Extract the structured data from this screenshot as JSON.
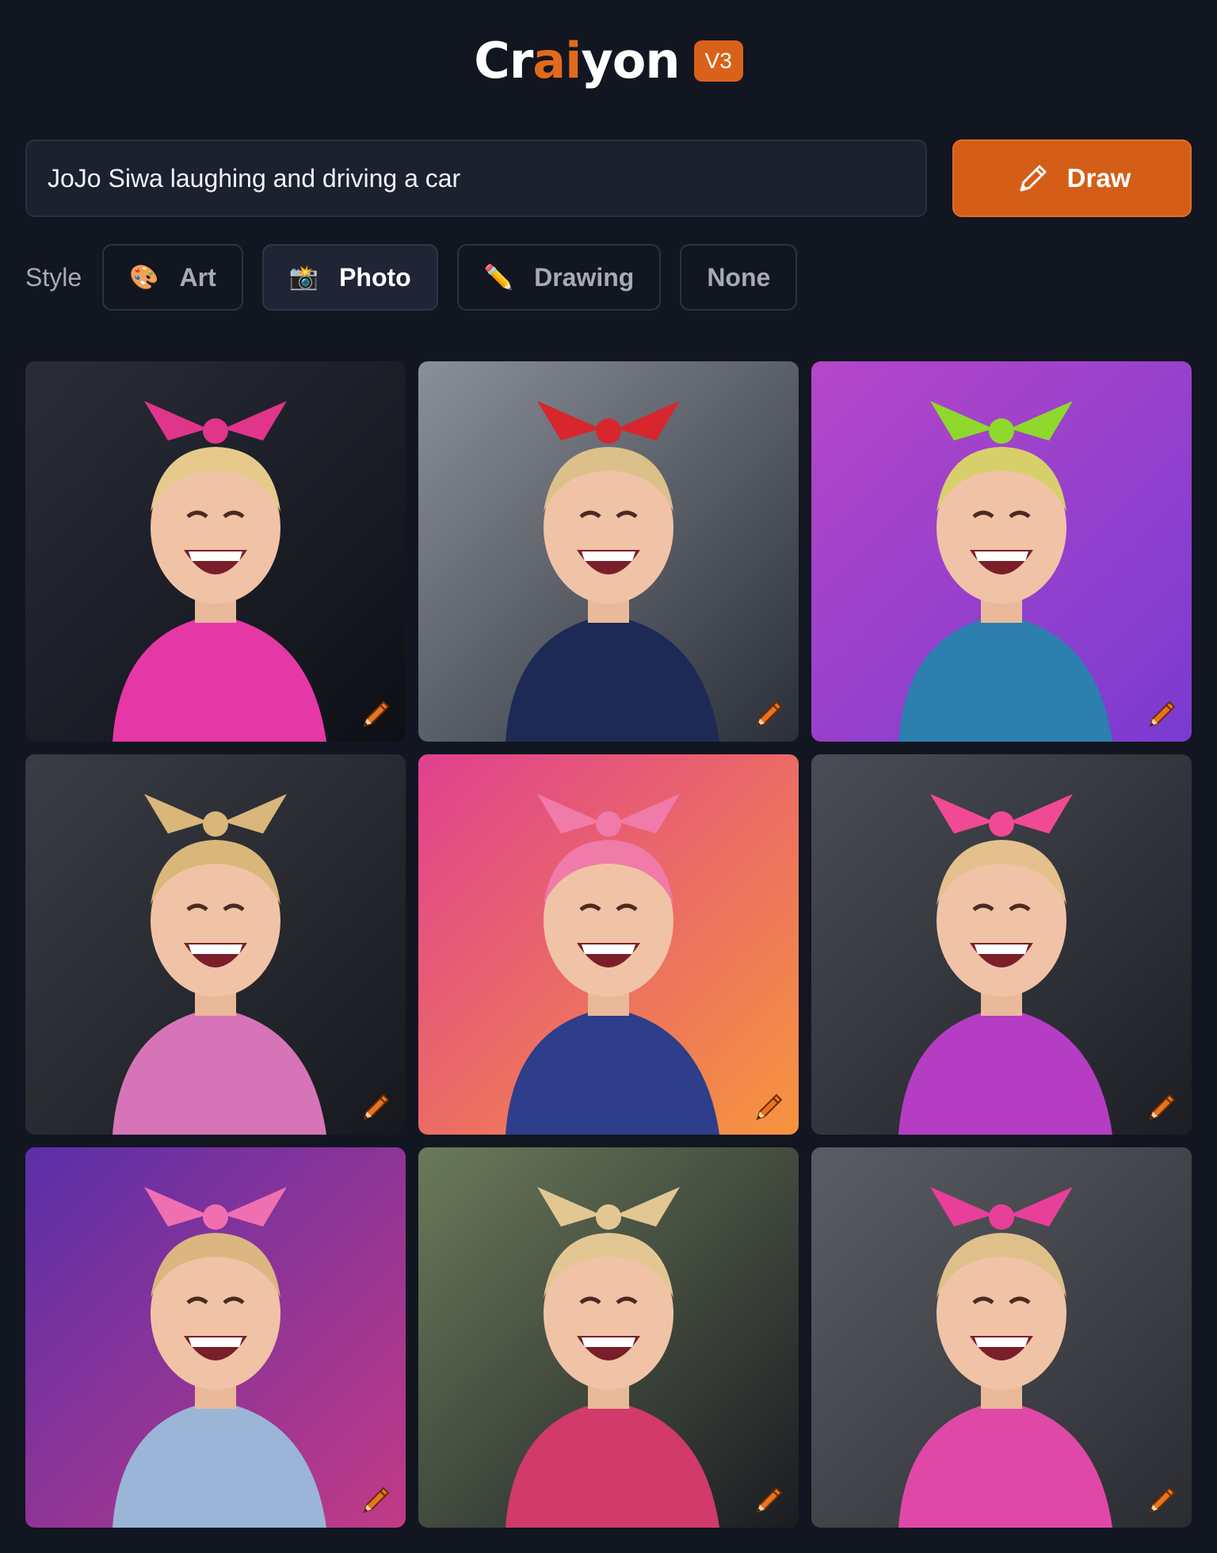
{
  "header": {
    "logo_pre": "Cr",
    "logo_accent": "ai",
    "logo_post": "yon",
    "version_badge": "V3"
  },
  "prompt": {
    "value": "JoJo Siwa laughing and driving a car",
    "draw_label": "Draw"
  },
  "style": {
    "label": "Style",
    "options": [
      {
        "label": "Art",
        "icon": "palette-icon",
        "glyph": "🎨",
        "active": false
      },
      {
        "label": "Photo",
        "icon": "camera-icon",
        "glyph": "📸",
        "active": true
      },
      {
        "label": "Drawing",
        "icon": "pencil-icon",
        "glyph": "✏️",
        "active": false
      },
      {
        "label": "None",
        "icon": "",
        "glyph": "",
        "active": false
      }
    ]
  },
  "results": {
    "tiles": [
      {
        "bg1": "#2a2d38",
        "bg2": "#0e1016",
        "hair": "#e8c98c",
        "bow": "#e0358a",
        "outfit": "#e637a6"
      },
      {
        "bg1": "#8a8f98",
        "bg2": "#2b2f38",
        "hair": "#dcc08a",
        "bow": "#d8262f",
        "outfit": "#1d2a55"
      },
      {
        "bg1": "#b546c9",
        "bg2": "#7a3bd0",
        "hair": "#d7d06a",
        "bow": "#8ed92c",
        "outfit": "#2d7fb0"
      },
      {
        "bg1": "#3a3d44",
        "bg2": "#16181d",
        "hair": "#d9b67a",
        "bow": "#d9b67a",
        "outfit": "#d774b8"
      },
      {
        "bg1": "#e0418f",
        "bg2": "#f6953d",
        "hair": "#f07aa8",
        "bow": "#f07aa8",
        "outfit": "#2e3e8a"
      },
      {
        "bg1": "#4a4d55",
        "bg2": "#1c1e24",
        "hair": "#e3c08c",
        "bow": "#f04a94",
        "outfit": "#b53dc4"
      },
      {
        "bg1": "#5a2fa8",
        "bg2": "#c23a86",
        "hair": "#dcb680",
        "bow": "#f06fb0",
        "outfit": "#9ab5d6"
      },
      {
        "bg1": "#6b7a5a",
        "bg2": "#1a1c22",
        "hair": "#e3c793",
        "bow": "#e3c793",
        "outfit": "#d13a6a"
      },
      {
        "bg1": "#5a5d63",
        "bg2": "#2a2c31",
        "hair": "#e0c08a",
        "bow": "#e83f9a",
        "outfit": "#e048a8"
      }
    ]
  },
  "colors": {
    "accent": "#d45e17",
    "background": "#121620",
    "input_bg": "#1c2130"
  }
}
